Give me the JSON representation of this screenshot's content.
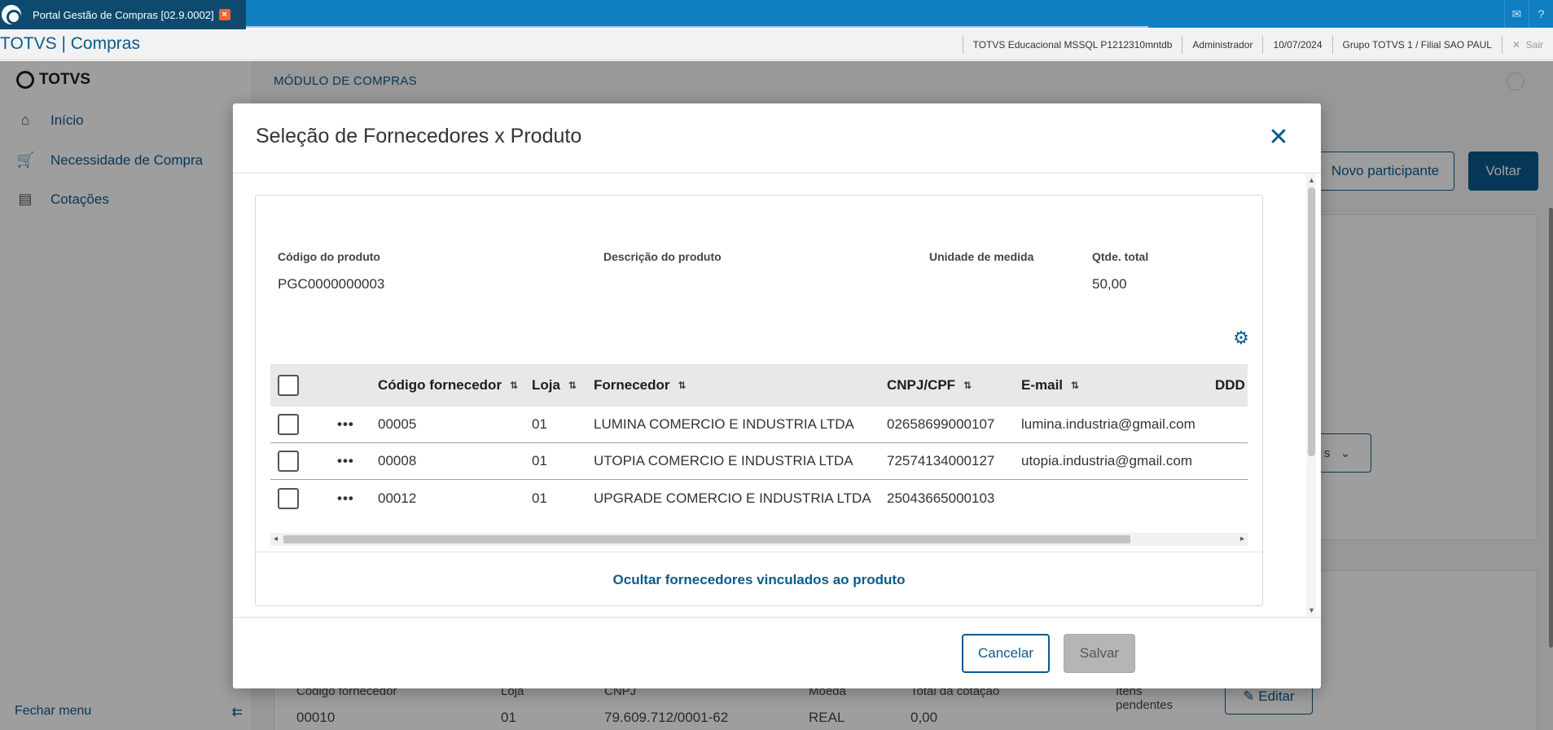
{
  "browser": {
    "tab_title": "Portal Gestão de Compras [02.9.0002]"
  },
  "header": {
    "brand": "TOTVS | Compras",
    "environment": "TOTVS Educacional MSSQL P1212310mntdb",
    "user": "Administrador",
    "date": "10/07/2024",
    "branch": "Grupo TOTVS 1 / Filial SAO PAUL",
    "exit_label": "Sair"
  },
  "sidebar": {
    "logo": "TOTVS",
    "items": [
      {
        "label": "Início",
        "icon": "home-icon"
      },
      {
        "label": "Necessidade de Compra",
        "icon": "cart-icon"
      },
      {
        "label": "Cotações",
        "icon": "document-icon"
      }
    ],
    "footer_label": "Fechar menu"
  },
  "background": {
    "module_title": "MÓDULO DE COMPRAS",
    "btn_new_participant": "Novo participante",
    "btn_back": "Voltar",
    "select_fragment": "s",
    "table_headers": [
      "Código fornecedor",
      "Loja",
      "CNPJ",
      "Moeda",
      "Total da cotação",
      "Itens pendentes"
    ],
    "table_row": [
      "00010",
      "01",
      "79.609.712/0001-62",
      "REAL",
      "0,00"
    ],
    "edit_label": "Editar"
  },
  "modal": {
    "title": "Seleção de Fornecedores x Produto",
    "product": {
      "code_label": "Código do produto",
      "code_value": "PGC0000000003",
      "desc_label": "Descrição do produto",
      "desc_value": "",
      "unit_label": "Unidade de medida",
      "unit_value": "",
      "qty_label": "Qtde. total",
      "qty_value": "50,00"
    },
    "grid": {
      "columns": [
        "Código fornecedor",
        "Loja",
        "Fornecedor",
        "CNPJ/CPF",
        "E-mail",
        "DDD"
      ],
      "rows": [
        {
          "code": "00005",
          "store": "01",
          "supplier": "LUMINA COMERCIO E INDUSTRIA LTDA",
          "cnpj": "02658699000107",
          "email": "lumina.industria@gmail.com"
        },
        {
          "code": "00008",
          "store": "01",
          "supplier": "UTOPIA COMERCIO E INDUSTRIA LTDA",
          "cnpj": "72574134000127",
          "email": "utopia.industria@gmail.com"
        },
        {
          "code": "00012",
          "store": "01",
          "supplier": "UPGRADE COMERCIO E INDUSTRIA LTDA",
          "cnpj": "25043665000103",
          "email": ""
        }
      ]
    },
    "toggle_link": "Ocultar fornecedores vinculados ao produto",
    "cancel_label": "Cancelar",
    "save_label": "Salvar"
  }
}
